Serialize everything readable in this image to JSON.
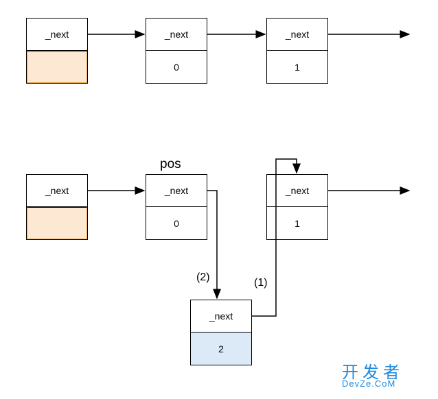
{
  "field_label": "_next",
  "row1": {
    "nodes": [
      {
        "top": "_next",
        "bottom": ""
      },
      {
        "top": "_next",
        "bottom": "0"
      },
      {
        "top": "_next",
        "bottom": "1"
      }
    ]
  },
  "row2": {
    "pos_label": "pos",
    "nodes": [
      {
        "top": "_next",
        "bottom": ""
      },
      {
        "top": "_next",
        "bottom": "0"
      },
      {
        "top": "_next",
        "bottom": "1"
      }
    ],
    "inserted": {
      "top": "_next",
      "bottom": "2"
    },
    "step1_label": "(1)",
    "step2_label": "(2)"
  },
  "watermark": {
    "brand": "开发者",
    "sub": "DevZe.CoM"
  }
}
